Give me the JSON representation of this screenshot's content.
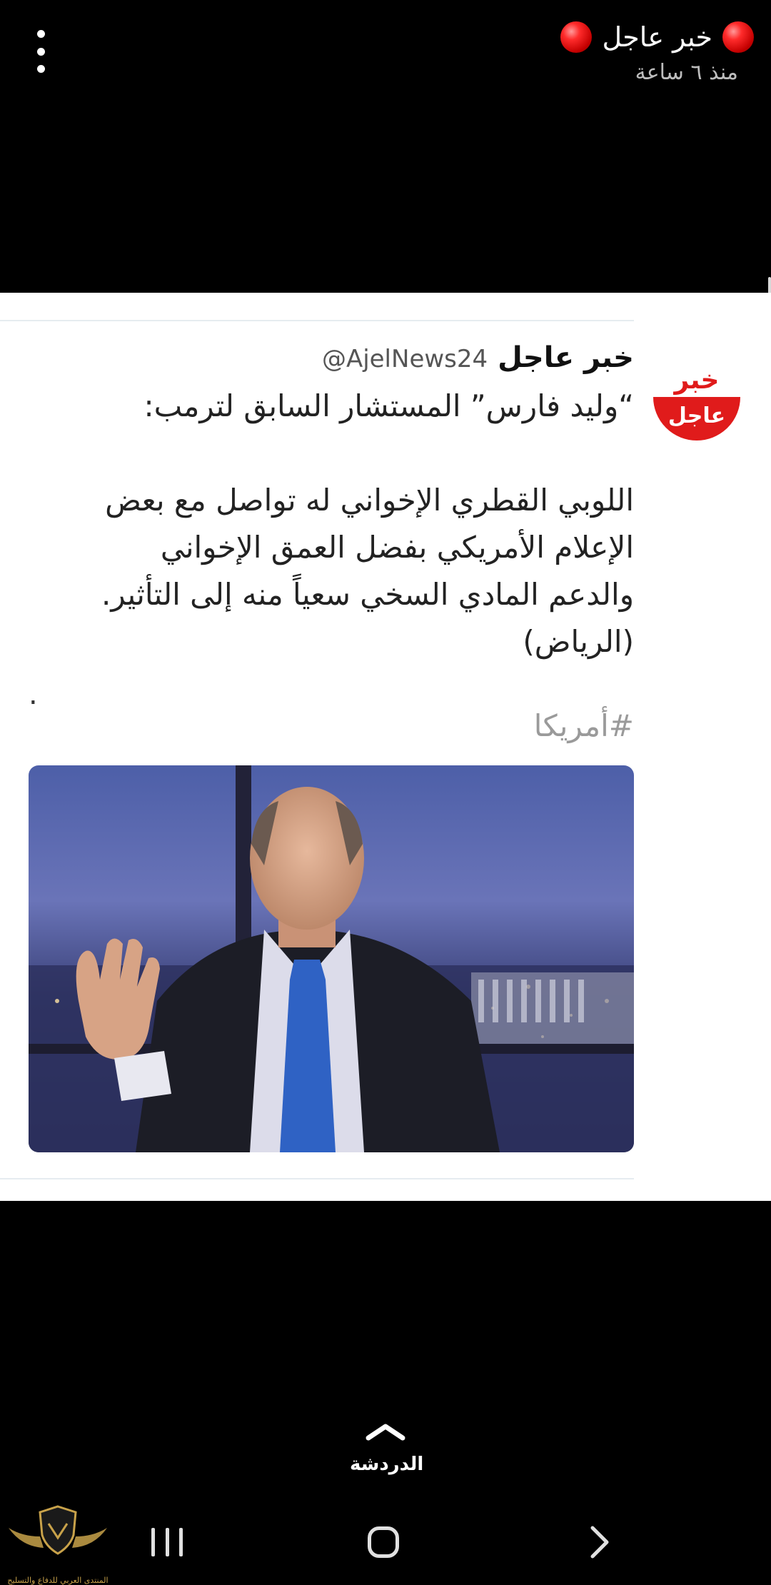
{
  "story": {
    "title": "خبر عاجل",
    "time": "منذ ٦ ساعة"
  },
  "tweet": {
    "avatar_text_top": "خبر",
    "avatar_text_bottom": "عاجل",
    "name": "خبر عاجل",
    "handle": "@AjelNews24",
    "line1": "“وليد فارس” المستشار السابق لترمب:",
    "line2": "اللوبي القطري الإخواني له تواصل مع بعض",
    "line3": "الإعلام الأمريكي بفضل العمق الإخواني",
    "line4": "والدعم المادي السخي سعياً منه إلى التأثير.",
    "line5": "(الرياض)",
    "dot": ".",
    "hashtag": "#أمريكا"
  },
  "bottom": {
    "chat_label": "الدردشة"
  },
  "watermark": {
    "text": "المنتدى العربي للدفاع والتسليح"
  },
  "colors": {
    "accent_red": "#d91c1c",
    "background": "#000000",
    "card": "#ffffff"
  },
  "icons": [
    "more-vert-icon",
    "red-circle-icon",
    "chevron-up-icon",
    "recent-apps-icon",
    "home-icon",
    "back-icon"
  ]
}
